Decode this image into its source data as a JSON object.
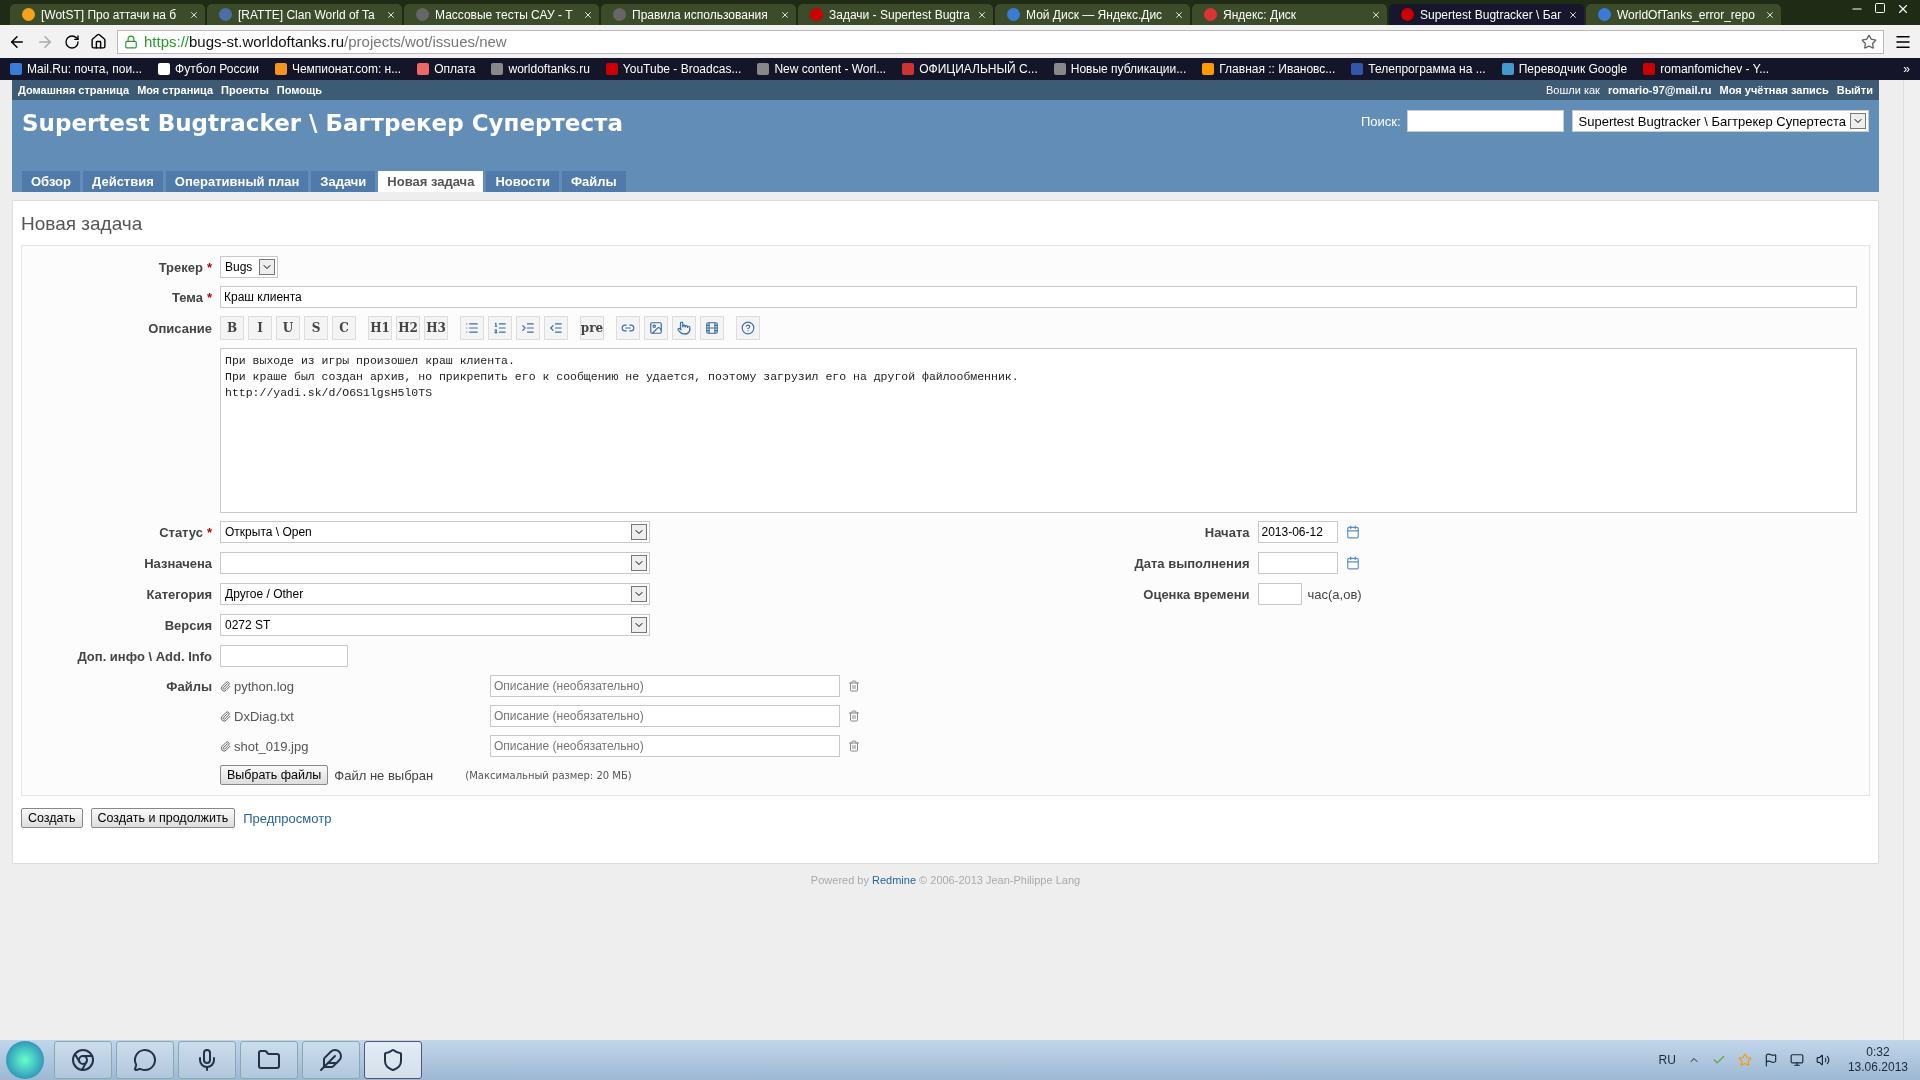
{
  "browser": {
    "tabs": [
      {
        "title": "[WotST] Про аттачи на б",
        "selected": false
      },
      {
        "title": "[RATTE] Clan World of Ta",
        "selected": false
      },
      {
        "title": "Массовые тесты САУ - Т",
        "selected": false
      },
      {
        "title": "Правила использования",
        "selected": false
      },
      {
        "title": "Задачи - Supertest Bugtra",
        "selected": false
      },
      {
        "title": "Мой Диск — Яндекс.Дис",
        "selected": false
      },
      {
        "title": "Яндекс: Диск",
        "selected": false
      },
      {
        "title": "Supertest Bugtracker \\ Баг",
        "selected": true
      },
      {
        "title": "WorldOfTanks_error_repo",
        "selected": false
      }
    ],
    "url": {
      "scheme": "https://",
      "host": "bugs-st.worldoftanks.ru",
      "path": "/projects/wot/issues/new"
    },
    "bookmarks": [
      "Mail.Ru: почта, пои...",
      "Футбол России",
      "Чемпионат.com: н...",
      "Оплата",
      "worldoftanks.ru",
      "YouTube - Broadcas...",
      "New content - Worl...",
      "ОФИЦИАЛЬНЫЙ С...",
      "Новые публикации...",
      "Главная :: Ивановс...",
      "Телепрограмма на ...",
      "Переводчик Google",
      "romanfomichev - Y..."
    ],
    "bookmarks_more": "»"
  },
  "top_menu": [
    "Домашняя страница",
    "Моя страница",
    "Проекты",
    "Помощь"
  ],
  "account": {
    "logged_in_label": "Вошли как",
    "user": "romario-97@mail.ru",
    "links": [
      "Моя учётная запись",
      "Выйти"
    ]
  },
  "header": {
    "title": "Supertest Bugtracker \\ Багтрекер Супертеста",
    "search_label": "Поиск:",
    "project_select": "Supertest Bugtracker \\ Багтрекер Супертеста"
  },
  "main_tabs": [
    {
      "label": "Обзор",
      "selected": false
    },
    {
      "label": "Действия",
      "selected": false
    },
    {
      "label": "Оперативный план",
      "selected": false
    },
    {
      "label": "Задачи",
      "selected": false
    },
    {
      "label": "Новая задача",
      "selected": true
    },
    {
      "label": "Новости",
      "selected": false
    },
    {
      "label": "Файлы",
      "selected": false
    }
  ],
  "heading": "Новая задача",
  "form": {
    "tracker": {
      "label": "Трекер",
      "required_mark": "*",
      "value": "Bugs"
    },
    "subject": {
      "label": "Тема",
      "required_mark": "*",
      "value": "Краш клиента"
    },
    "description": {
      "label": "Описание",
      "toolbar": [
        {
          "kind": "text",
          "label": "B"
        },
        {
          "kind": "text",
          "label": "I"
        },
        {
          "kind": "text",
          "label": "U"
        },
        {
          "kind": "text",
          "label": "S"
        },
        {
          "kind": "text",
          "label": "C"
        },
        {
          "kind": "text",
          "label": "H1"
        },
        {
          "kind": "text",
          "label": "H2"
        },
        {
          "kind": "text",
          "label": "H3"
        },
        {
          "kind": "icon"
        },
        {
          "kind": "icon"
        },
        {
          "kind": "icon"
        },
        {
          "kind": "icon"
        },
        {
          "kind": "text",
          "label": "pre"
        },
        {
          "kind": "icon"
        },
        {
          "kind": "icon"
        },
        {
          "kind": "icon"
        },
        {
          "kind": "icon"
        },
        {
          "kind": "icon"
        }
      ],
      "lines": [
        "При выходе из игры произошел краш клиента.",
        "При краше был создан архив, но прикрепить его к сообщению не удается, поэтому загрузил его на другой файлообменник.",
        "http://yadi.sk/d/O6S1lgsH5l0TS"
      ]
    },
    "left_fields": [
      {
        "kind": "select",
        "label": "Статус",
        "required_mark": "*",
        "value": "Открыта \\ Open"
      },
      {
        "kind": "select",
        "label": "Назначена"
      },
      {
        "kind": "select",
        "label": "Категория",
        "value": "Другое / Other"
      },
      {
        "kind": "select",
        "label": "Версия",
        "value": "0272 ST"
      },
      {
        "kind": "input",
        "label": "Доп. инфо \\ Add. Info"
      }
    ],
    "right_fields": [
      {
        "kind": "date",
        "label": "Начата",
        "value": "2013-06-12"
      },
      {
        "kind": "date",
        "label": "Дата выполнения"
      },
      {
        "kind": "hours",
        "label": "Оценка времени",
        "unit": "час(а,ов)"
      }
    ],
    "files": {
      "label": "Файлы",
      "items": [
        {
          "name": "python.log",
          "placeholder": "Описание (необязательно)"
        },
        {
          "name": "DxDiag.txt",
          "placeholder": "Описание (необязательно)"
        },
        {
          "name": "shot_019.jpg",
          "placeholder": "Описание (необязательно)"
        }
      ],
      "choose_button": "Выбрать файлы",
      "no_file": "Файл не выбран",
      "max_size": "(Максимальный размер: 20 МБ)"
    },
    "buttons": [
      "Создать",
      "Создать и продолжить"
    ],
    "preview_link": "Предпросмотр"
  },
  "footer": {
    "text_before": "Powered by",
    "link": "Redmine",
    "text_after": "© 2006-2013 Jean-Philippe Lang"
  },
  "taskbar": {
    "apps": [
      {
        "kind": "browser",
        "selected": false
      },
      {
        "kind": "chat",
        "selected": false
      },
      {
        "kind": "voice",
        "selected": false
      },
      {
        "kind": "folder",
        "selected": false
      },
      {
        "kind": "feather",
        "selected": false
      },
      {
        "kind": "game",
        "selected": true
      }
    ],
    "language": "RU",
    "time": "0:32",
    "date": "13.06.2013"
  }
}
